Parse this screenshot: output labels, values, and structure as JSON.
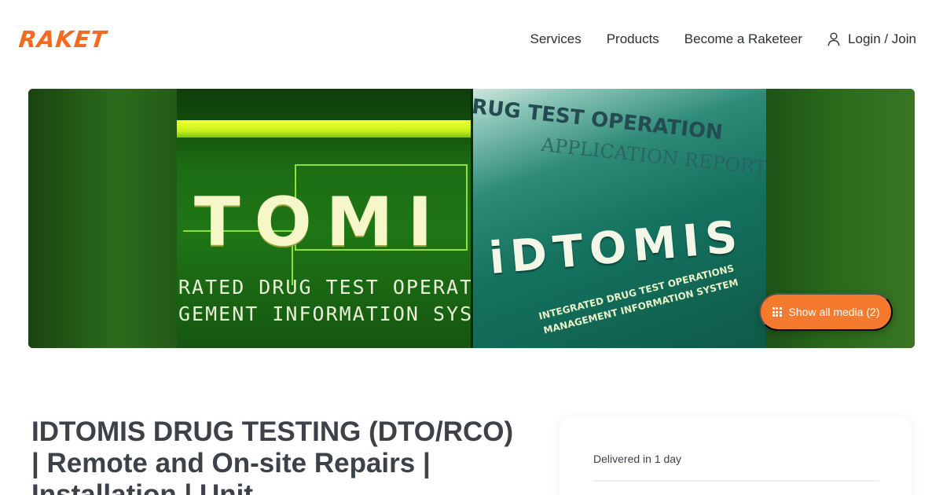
{
  "header": {
    "logo": "RAKET",
    "nav": [
      "Services",
      "Products",
      "Become a Raketeer"
    ],
    "login_label": "Login / Join"
  },
  "hero": {
    "image_a": {
      "brand": "TOMI",
      "line1": "RATED DRUG TEST OPERAT",
      "line2": "GEMENT INFORMATION SYS"
    },
    "image_b": {
      "header": "RUG TEST OPERATION",
      "app": "APPLICATION   REPORT",
      "brand": "iDTOMIS",
      "sub1": "INTEGRATED DRUG TEST OPERATIONS",
      "sub2": "MANAGEMENT INFORMATION SYSTEM"
    },
    "show_media_label": "Show all media (2)"
  },
  "listing": {
    "title": "IDTOMIS DRUG TESTING (DTO/RCO) | Remote and On-site Repairs | Installation | Unit"
  },
  "card": {
    "delivered": "Delivered in 1 day"
  },
  "colors": {
    "brand_orange": "#f26b21",
    "button_orange": "#f57a2d",
    "text_dark": "#2b2f33"
  },
  "icons": [
    "user-icon",
    "grid-icon"
  ]
}
